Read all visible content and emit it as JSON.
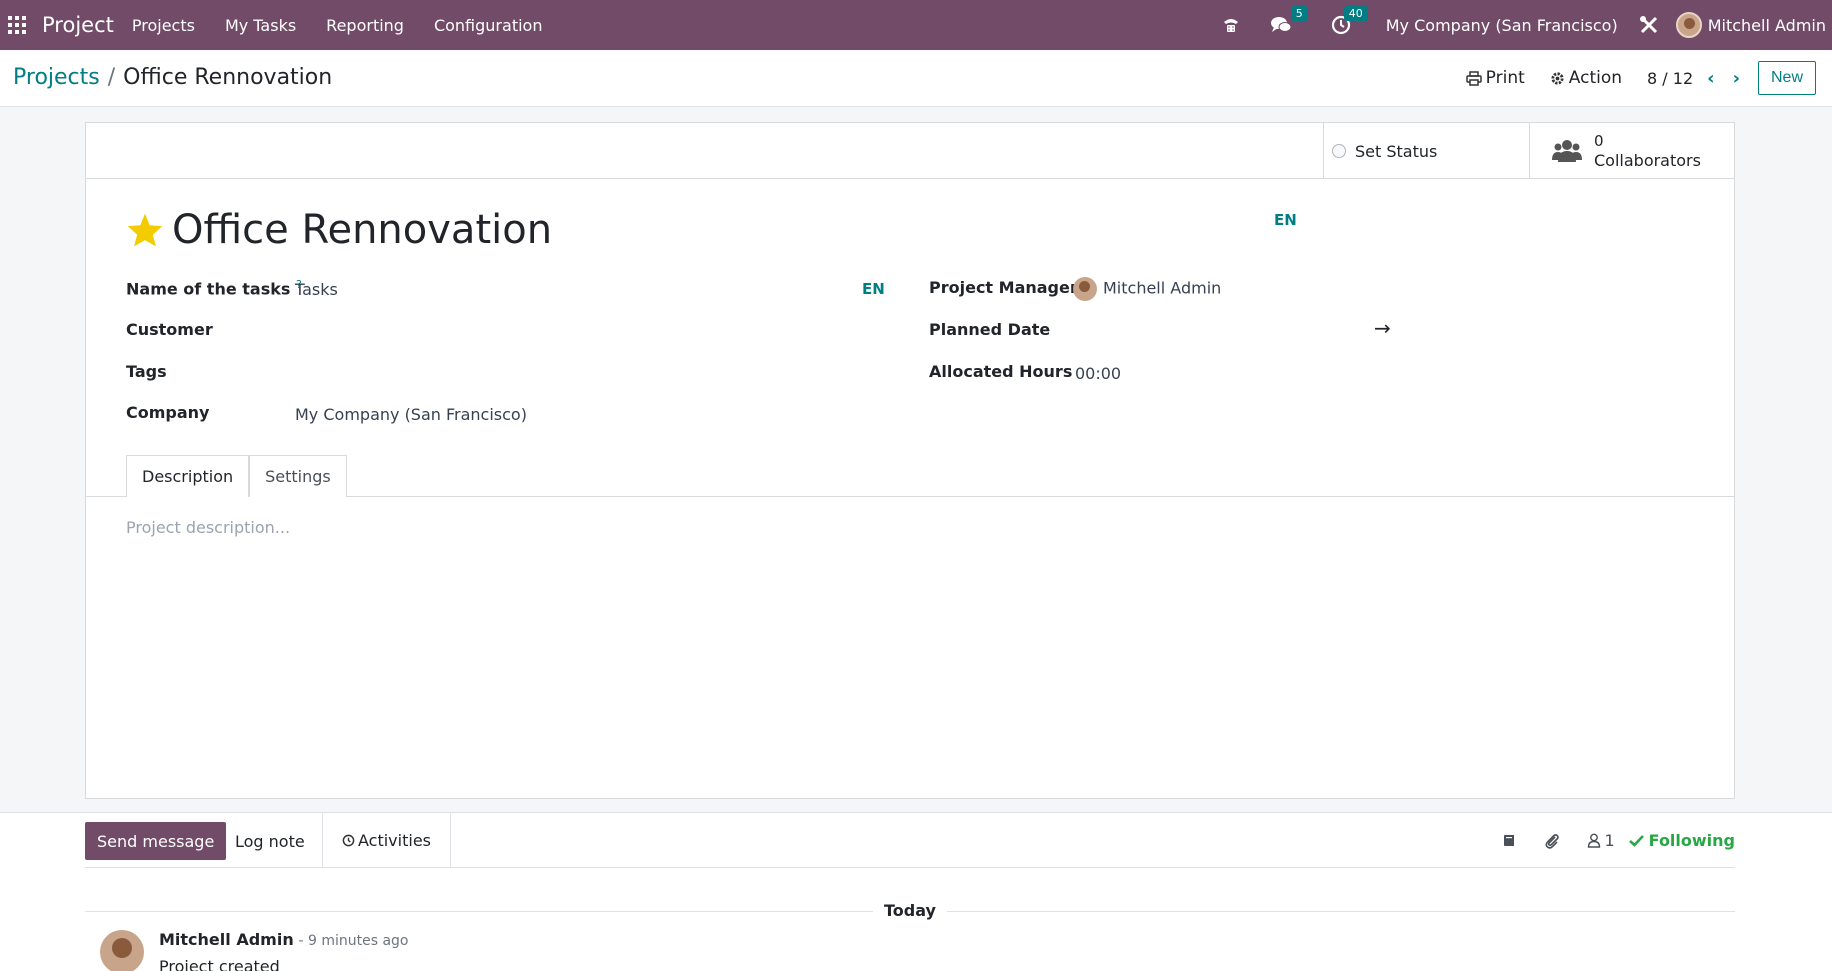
{
  "navbar": {
    "app_name": "Project",
    "menu": [
      "Projects",
      "My Tasks",
      "Reporting",
      "Configuration"
    ],
    "messages_count": "5",
    "activities_count": "40",
    "company": "My Company (San Francisco)",
    "user": "Mitchell Admin",
    "bg_color": "#714b67"
  },
  "breadcrumb": {
    "parent": "Projects",
    "separator": "/",
    "current": "Office Rennovation"
  },
  "control": {
    "print_label": "Print",
    "action_label": "Action",
    "pager": "8 / 12",
    "new_label": "New"
  },
  "status": {
    "set_status_label": "Set Status",
    "collaborators_count": "0",
    "collaborators_label": "Collaborators"
  },
  "form": {
    "title": "Office Rennovation",
    "title_lang": "EN",
    "favorite": true,
    "tasks_label": "Name of the tasks",
    "tasks_help": "?",
    "tasks_value": "Tasks",
    "tasks_lang": "EN",
    "customer_label": "Customer",
    "customer_value": "",
    "tags_label": "Tags",
    "tags_value": "",
    "company_label": "Company",
    "company_value": "My Company (San Francisco)",
    "pm_label": "Project Manager",
    "pm_value": "Mitchell Admin",
    "planned_label": "Planned Date",
    "planned_arrow": "→",
    "allocated_label": "Allocated Hours",
    "allocated_value": "00:00"
  },
  "tabs": [
    "Description",
    "Settings"
  ],
  "description_placeholder": "Project description...",
  "chatter": {
    "send_label": "Send message",
    "log_label": "Log note",
    "activities_label": "Activities",
    "followers_count": "1",
    "following_label": "Following",
    "today_label": "Today",
    "message": {
      "author": "Mitchell Admin",
      "time": "- 9 minutes ago",
      "text": "Project created"
    }
  }
}
